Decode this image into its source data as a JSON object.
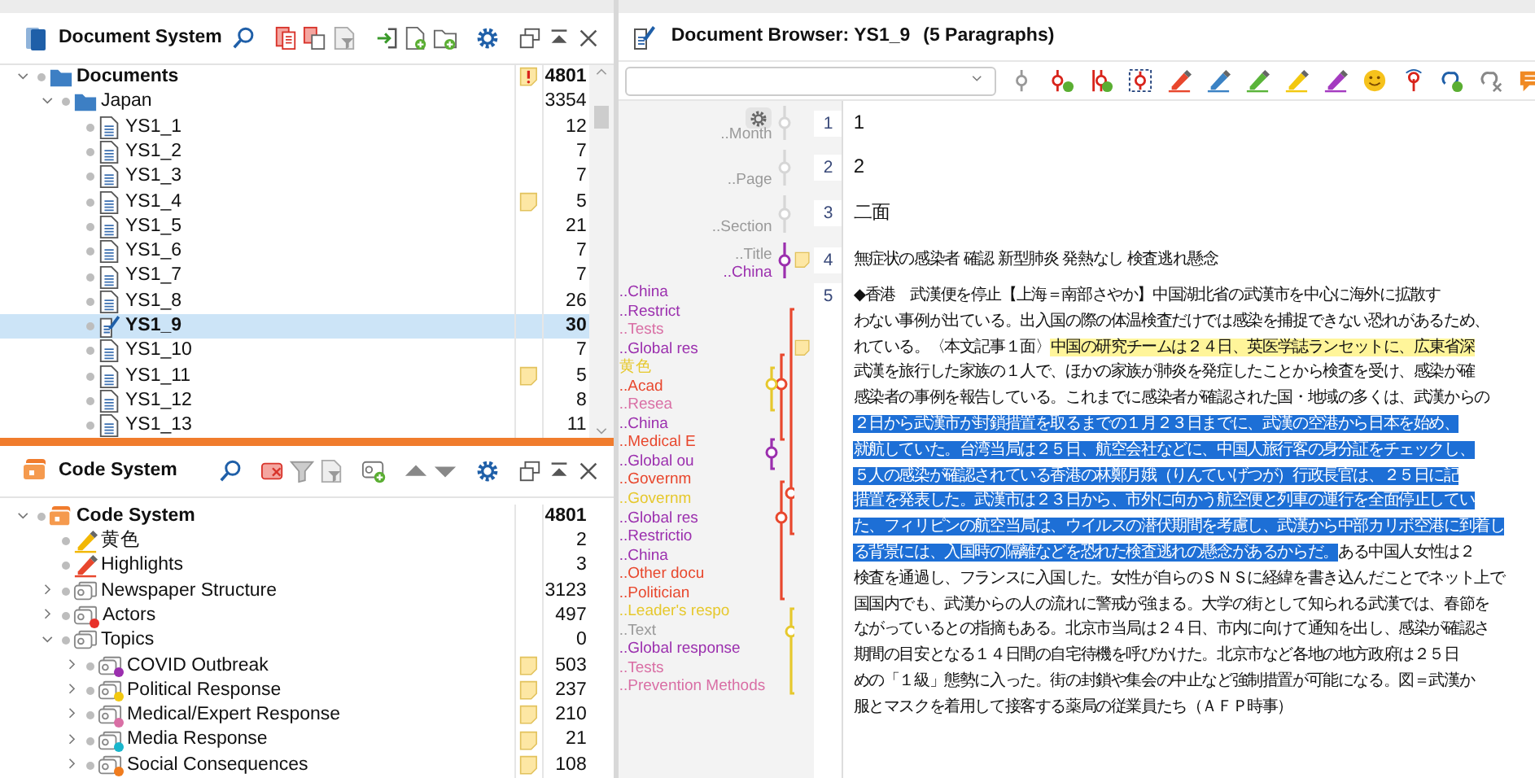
{
  "document_system": {
    "title": "Document System",
    "tree": [
      {
        "name": "Documents",
        "count": "4801",
        "memo": true,
        "alert": true,
        "expanded": true,
        "selected": false,
        "children": [
          {
            "name": "Japan",
            "count": "3354",
            "expanded": true,
            "selected": false,
            "children": [
              {
                "name": "YS1_1",
                "count": "12",
                "selected": false
              },
              {
                "name": "YS1_2",
                "count": "7",
                "selected": false
              },
              {
                "name": "YS1_3",
                "count": "7",
                "selected": false
              },
              {
                "name": "YS1_4",
                "count": "5",
                "memo": true,
                "selected": false
              },
              {
                "name": "YS1_5",
                "count": "21",
                "selected": false
              },
              {
                "name": "YS1_6",
                "count": "7",
                "selected": false
              },
              {
                "name": "YS1_7",
                "count": "7",
                "selected": false
              },
              {
                "name": "YS1_8",
                "count": "26",
                "selected": false
              },
              {
                "name": "YS1_9",
                "count": "30",
                "selected": true
              },
              {
                "name": "YS1_10",
                "count": "7",
                "selected": false
              },
              {
                "name": "YS1_11",
                "count": "5",
                "memo": true,
                "selected": false
              },
              {
                "name": "YS1_12",
                "count": "8",
                "selected": false
              },
              {
                "name": "YS1_13",
                "count": "11",
                "selected": false
              }
            ]
          }
        ]
      }
    ]
  },
  "code_system": {
    "title": "Code System",
    "tree": [
      {
        "kind": "root",
        "name": "Code System",
        "count": "4801",
        "expanded": true,
        "children": [
          {
            "kind": "highlight",
            "name": "黄色",
            "count": "2",
            "color": "#f2b705"
          },
          {
            "kind": "highlight",
            "name": "Highlights",
            "count": "3",
            "color": "#e8472d"
          },
          {
            "kind": "code",
            "name": "Newspaper Structure",
            "count": "3123",
            "expanded": false
          },
          {
            "kind": "code",
            "name": "Actors",
            "count": "497",
            "expanded": false,
            "color": "#e8312a"
          },
          {
            "kind": "code",
            "name": "Topics",
            "count": "0",
            "expanded": true,
            "children": [
              {
                "kind": "code",
                "name": "COVID Outbreak",
                "count": "503",
                "memo": true,
                "expanded": false,
                "color": "#9b2fae"
              },
              {
                "kind": "code",
                "name": "Political Response",
                "count": "237",
                "memo": true,
                "expanded": false,
                "color": "#f2c80f"
              },
              {
                "kind": "code",
                "name": "Medical/Expert Response",
                "count": "210",
                "memo": true,
                "expanded": false,
                "color": "#d96fa5"
              },
              {
                "kind": "code",
                "name": "Media Response",
                "count": "21",
                "memo": true,
                "expanded": false,
                "color": "#19b6cc"
              },
              {
                "kind": "code",
                "name": "Social Consequences",
                "count": "108",
                "memo": true,
                "expanded": false,
                "color": "#f07c1e"
              }
            ]
          }
        ]
      }
    ]
  },
  "document_browser": {
    "title": "Document Browser: YS1_9",
    "paragraph_count": "(5 Paragraphs)",
    "paragraphs": [
      {
        "number": "1",
        "code_labels": [
          {
            "text": "..Month",
            "color": "#9a9a9a"
          }
        ],
        "lines": [
          {
            "segments": [
              {
                "text": "1"
              }
            ]
          }
        ]
      },
      {
        "number": "2",
        "code_labels": [
          {
            "text": "..Page",
            "color": "#9a9a9a"
          }
        ],
        "lines": [
          {
            "segments": [
              {
                "text": "2"
              }
            ]
          }
        ]
      },
      {
        "number": "3",
        "code_labels": [
          {
            "text": "..Section",
            "color": "#9a9a9a"
          }
        ],
        "lines": [
          {
            "segments": [
              {
                "text": "二面"
              }
            ]
          }
        ]
      },
      {
        "number": "4",
        "code_labels": [
          {
            "text": "..Title",
            "color": "#9a9a9a"
          },
          {
            "text": "..China",
            "color": "#9b2fae"
          }
        ],
        "lines": [
          {
            "memo": true,
            "segments": [
              {
                "text": "無症状の感染者 確認 新型肺炎 発熱なし 検査逃れ懸念"
              }
            ]
          }
        ]
      },
      {
        "number": "5",
        "code_labels": [
          {
            "text": "..China",
            "color": "#9b2fae"
          },
          {
            "text": "..Restrict",
            "color": "#9b2fae"
          },
          {
            "text": "..Tests",
            "color": "#d96fa5"
          },
          {
            "text": "..Global res",
            "color": "#9b2fae"
          },
          {
            "text": "黄色",
            "color": "#e6c82d"
          },
          {
            "text": "..Acad",
            "color": "#e8472d"
          },
          {
            "text": "..Resea",
            "color": "#d96fa5"
          },
          {
            "text": "..China",
            "color": "#9b2fae"
          },
          {
            "text": "..Medical E",
            "color": "#e8472d"
          },
          {
            "text": "..Global ou",
            "color": "#9b2fae"
          },
          {
            "text": "..Governm",
            "color": "#e8472d"
          },
          {
            "text": "..Governm",
            "color": "#e6c82d"
          },
          {
            "text": "..Global res",
            "color": "#9b2fae"
          },
          {
            "text": "..Restrictio",
            "color": "#9b2fae"
          },
          {
            "text": "..China",
            "color": "#9b2fae"
          },
          {
            "text": "..Other docu",
            "color": "#e8472d"
          },
          {
            "text": "..Politician",
            "color": "#e8472d"
          },
          {
            "text": "..Leader's respo",
            "color": "#e6c82d"
          },
          {
            "text": "..Text",
            "color": "#9a9a9a"
          },
          {
            "text": "..Global response",
            "color": "#9b2fae"
          },
          {
            "text": "..Tests",
            "color": "#d96fa5"
          },
          {
            "text": "..Prevention Methods",
            "color": "#d96fa5"
          }
        ],
        "lines": [
          {
            "segments": [
              {
                "text": "◆香港　武漢便を停止【上海＝南部さやか】中国湖北省の武漢市を中心に海外に拡散す"
              }
            ]
          },
          {
            "segments": [
              {
                "text": "わない事例が出ている。出入国の際の体温検査だけでは感染を捕捉できない恐れがあるため、"
              }
            ]
          },
          {
            "memo": true,
            "segments": [
              {
                "text": "れている。〈本文記事１面〉"
              },
              {
                "text": "中国の研究チームは２４日、英医学誌ランセットに、広東省深",
                "coded": true
              }
            ]
          },
          {
            "segments": [
              {
                "text": "武漢を旅行した家族の１人で、ほかの家族が肺炎を発症したことから検査を受け、感染が確"
              }
            ]
          },
          {
            "segments": [
              {
                "text": "感染者の事例を報告している。これまでに感染者が確認された国・地域の多くは、武漢からの"
              }
            ]
          },
          {
            "segments": [
              {
                "text": "２日から武漢市が封鎖措置を取るまでの１月２３日までに、武漢の空港から日本を始め、",
                "selected": true
              }
            ]
          },
          {
            "segments": [
              {
                "text": "就航していた。台湾当局は２５日、航空会社などに、中国人旅行客の身分証をチェックし、",
                "selected": true
              }
            ]
          },
          {
            "segments": [
              {
                "text": "５人の感染が確認されている香港の林鄭月娥（りんていげつが）行政長官は、２５日に記",
                "selected": true
              }
            ]
          },
          {
            "segments": [
              {
                "text": "措置を発表した。武漢市は２３日から、市外に向かう航空便と列車の運行を全面停止してい",
                "selected": true
              }
            ]
          },
          {
            "segments": [
              {
                "text": "た、フィリピンの航空当局は、ウイルスの潜伏期間を考慮し、武漢から中部カリボ空港に到着し",
                "selected": true
              }
            ]
          },
          {
            "segments": [
              {
                "text": "る背景には、入国時の隔離などを恐れた検査逃れの懸念があるからだ。",
                "selected": true
              },
              {
                "text": "ある中国人女性は２"
              }
            ]
          },
          {
            "segments": [
              {
                "text": "検査を通過し、フランスに入国した。女性が自らのＳＮＳに経緯を書き込んだことでネット上で"
              }
            ]
          },
          {
            "segments": [
              {
                "text": "国国内でも、武漢からの人の流れに警戒が強まる。大学の街として知られる武漢では、春節を"
              }
            ]
          },
          {
            "segments": [
              {
                "text": "ながっているとの指摘もある。北京市当局は２４日、市内に向けて通知を出し、感染が確認さ"
              }
            ]
          },
          {
            "segments": [
              {
                "text": "期間の目安となる１４日間の自宅待機を呼びかけた。北京市など各地の地方政府は２５日"
              }
            ]
          },
          {
            "segments": [
              {
                "text": "めの「１級」態勢に入った。街の封鎖や集会の中止など強制措置が可能になる。図＝武漢か"
              }
            ]
          },
          {
            "segments": [
              {
                "text": "服とマスクを着用して接客する薬局の従業員たち（ＡＦＰ時事）"
              }
            ]
          }
        ]
      }
    ]
  }
}
